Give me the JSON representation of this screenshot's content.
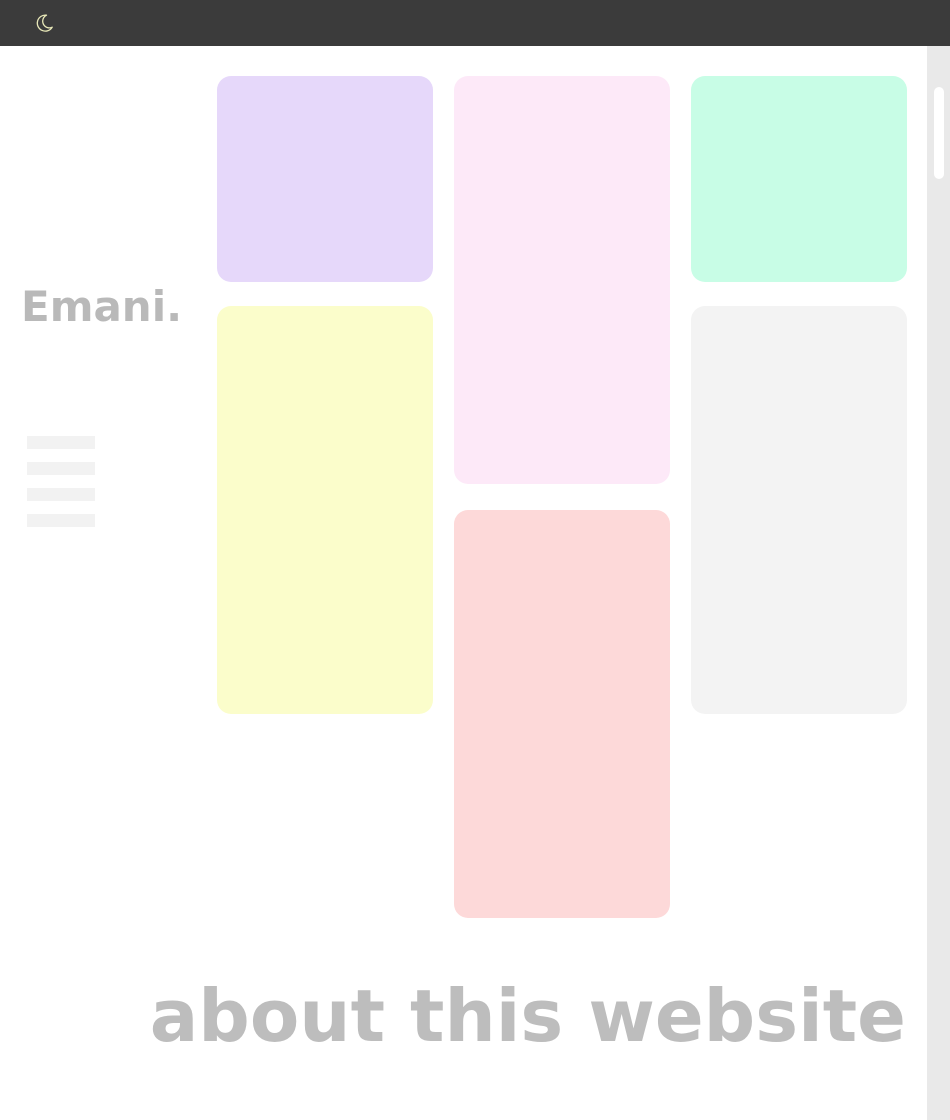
{
  "topbar": {
    "theme_toggle_icon": "moon-icon",
    "background": "#3b3b3b",
    "icon_color": "#e8e8b8"
  },
  "sidebar": {
    "brand": "Emani.",
    "menu_icon": "hamburger-menu-icon"
  },
  "gallery": {
    "tiles": [
      {
        "name": "tile-lavender",
        "color": "#e6d8fa"
      },
      {
        "name": "tile-pink",
        "color": "#fde9f8"
      },
      {
        "name": "tile-mint",
        "color": "#c8fde6"
      },
      {
        "name": "tile-yellow",
        "color": "#fbfdcb"
      },
      {
        "name": "tile-gray",
        "color": "#f3f3f3"
      },
      {
        "name": "tile-coral",
        "color": "#fdd9d9"
      }
    ]
  },
  "about": {
    "heading": "about this website"
  }
}
